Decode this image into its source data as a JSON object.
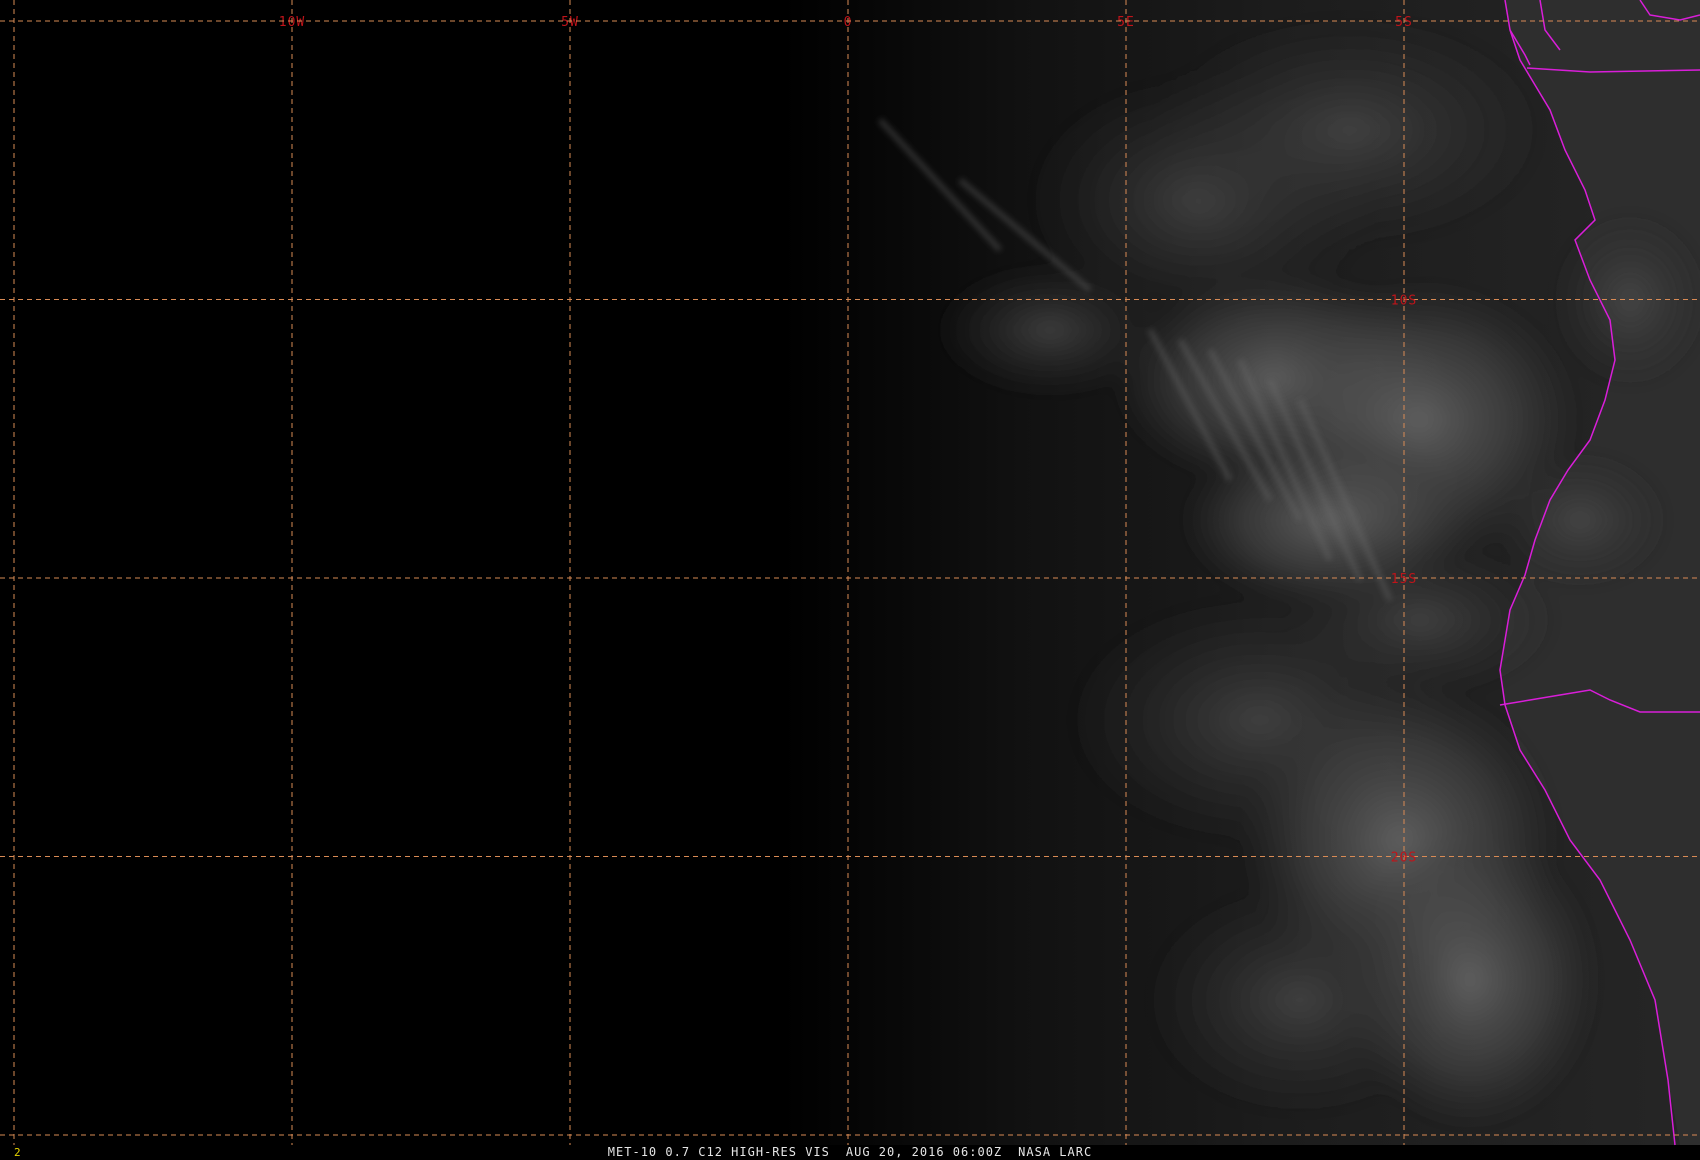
{
  "map": {
    "grid_line_color": "#d98b55",
    "label_color": "#c0141a",
    "border_color": "#d91ed9",
    "longitudes": [
      {
        "label": "10W",
        "value": -10
      },
      {
        "label": "5W",
        "value": -5
      },
      {
        "label": "0",
        "value": 0
      },
      {
        "label": "5E",
        "value": 5
      }
    ],
    "latitudes": [
      {
        "label": "5S",
        "value": -5
      },
      {
        "label": "10S",
        "value": -10
      },
      {
        "label": "15S",
        "value": -15
      },
      {
        "label": "20S",
        "value": -20
      }
    ]
  },
  "footer": {
    "frame_number": "2",
    "product": "MET-10 0.7 C12 HIGH-RES VIS",
    "datetime": "AUG 20, 2016 06:00Z",
    "source": "NASA LARC"
  }
}
